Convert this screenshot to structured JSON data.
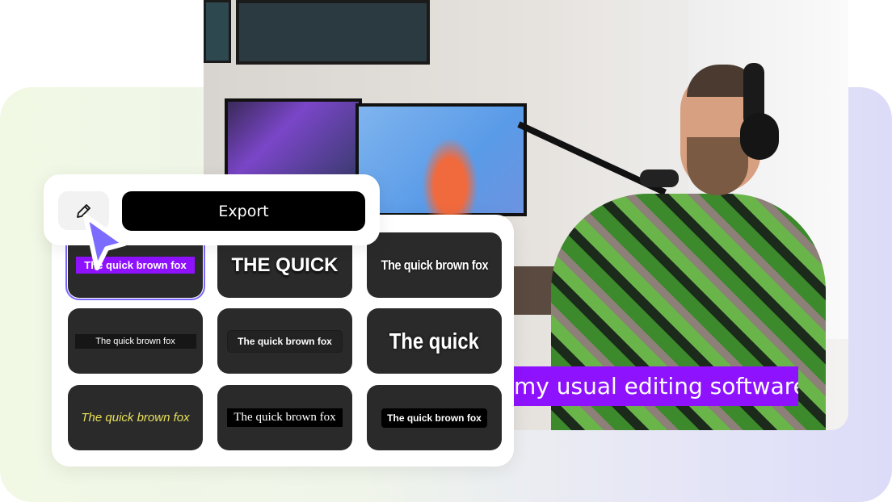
{
  "photo": {
    "caption": "my usual editing software",
    "caption_color": "#8f12fe"
  },
  "toolbar": {
    "edit_icon": "pencil-icon",
    "export_label": "Export"
  },
  "templates": [
    {
      "text": "The quick brown fox",
      "selected": true
    },
    {
      "text": "THE QUICK"
    },
    {
      "text": "The quick brown fox"
    },
    {
      "text": "The quick brown fox"
    },
    {
      "text": "The quick brown fox"
    },
    {
      "text": "The quick"
    },
    {
      "text": "The quick brown fox"
    },
    {
      "text": "The quick brown fox"
    },
    {
      "text": "The quick brown fox"
    }
  ],
  "colors": {
    "accent": "#7a67ff",
    "tile_bg": "#2a2a2a"
  }
}
